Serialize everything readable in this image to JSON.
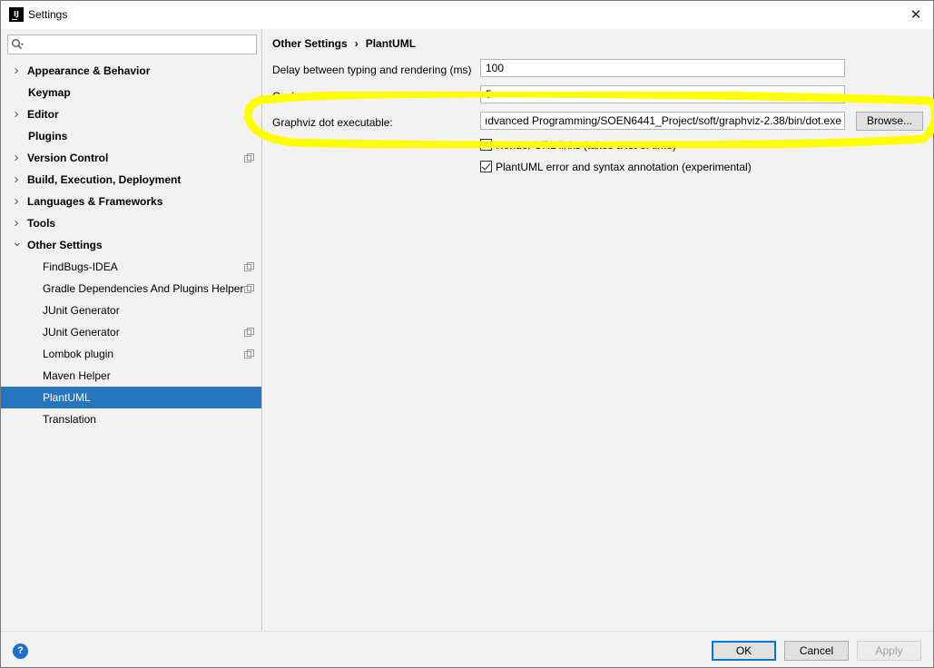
{
  "window": {
    "title": "Settings",
    "app_icon_text": "IJ"
  },
  "search": {
    "placeholder": ""
  },
  "sidebar": {
    "items": [
      {
        "label": "Appearance & Behavior",
        "level": 0,
        "arrow": "right"
      },
      {
        "label": "Keymap",
        "level": 0,
        "arrow": "none"
      },
      {
        "label": "Editor",
        "level": 0,
        "arrow": "right"
      },
      {
        "label": "Plugins",
        "level": 0,
        "arrow": "none"
      },
      {
        "label": "Version Control",
        "level": 0,
        "arrow": "right",
        "copy_icon": true
      },
      {
        "label": "Build, Execution, Deployment",
        "level": 0,
        "arrow": "right"
      },
      {
        "label": "Languages & Frameworks",
        "level": 0,
        "arrow": "right"
      },
      {
        "label": "Tools",
        "level": 0,
        "arrow": "right"
      },
      {
        "label": "Other Settings",
        "level": 0,
        "arrow": "down"
      },
      {
        "label": "FindBugs-IDEA",
        "level": 1,
        "copy_icon": true
      },
      {
        "label": "Gradle Dependencies And Plugins Helper",
        "level": 1,
        "copy_icon": true
      },
      {
        "label": "JUnit Generator",
        "level": 1
      },
      {
        "label": "JUnit Generator",
        "level": 1,
        "copy_icon": true
      },
      {
        "label": "Lombok plugin",
        "level": 1,
        "copy_icon": true
      },
      {
        "label": "Maven Helper",
        "level": 1
      },
      {
        "label": "PlantUML",
        "level": 1,
        "selected": true
      },
      {
        "label": "Translation",
        "level": 1
      }
    ]
  },
  "breadcrumb": {
    "parent": "Other Settings",
    "separator": "›",
    "current": "PlantUML"
  },
  "settings": {
    "delay_label": "Delay between typing and rendering (ms)",
    "delay_value": "100",
    "cache_label": "Cache size",
    "cache_value": "5",
    "graphviz_label": "Graphviz dot executable:",
    "graphviz_value": "ıdvanced Programming/SOEN6441_Project/soft/graphviz-2.38/bin/dot.exe",
    "browse_label": "Browse...",
    "render_url_label": "Render URL links (takes a lot of time)",
    "render_url_checked": false,
    "error_annotation_label": "PlantUML error and syntax annotation (experimental)",
    "error_annotation_checked": true
  },
  "annotation": {
    "highlight_color": "#ffff00"
  },
  "footer": {
    "help": "?",
    "ok": "OK",
    "cancel": "Cancel",
    "apply": "Apply"
  },
  "colors": {
    "selection": "#2675bf",
    "help_icon": "#1a6fd0"
  }
}
